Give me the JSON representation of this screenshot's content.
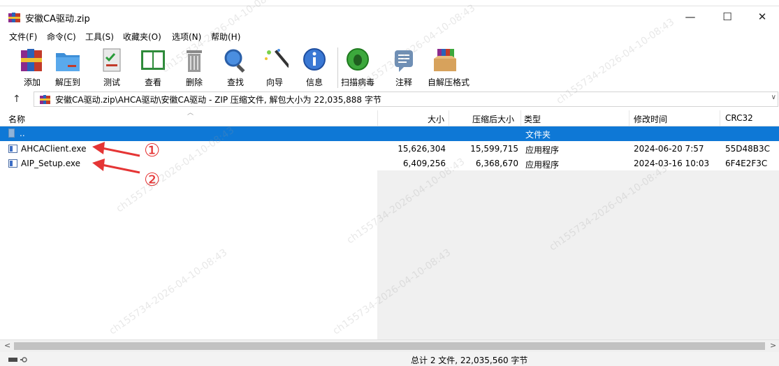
{
  "window": {
    "title": "安徽CA驱动.zip",
    "minimize": "—",
    "maximize": "☐",
    "close": "✕"
  },
  "menu": [
    "文件(F)",
    "命令(C)",
    "工具(S)",
    "收藏夹(O)",
    "选项(N)",
    "帮助(H)"
  ],
  "toolbar": [
    {
      "label": "添加",
      "icon": "books-icon"
    },
    {
      "label": "解压到",
      "icon": "folder-icon"
    },
    {
      "label": "测试",
      "icon": "checklist-icon"
    },
    {
      "label": "查看",
      "icon": "book-icon"
    },
    {
      "label": "删除",
      "icon": "trash-icon"
    },
    {
      "label": "查找",
      "icon": "magnifier-icon"
    },
    {
      "label": "向导",
      "icon": "wand-icon"
    },
    {
      "label": "信息",
      "icon": "info-icon"
    },
    {
      "label": "扫描病毒",
      "icon": "bug-icon"
    },
    {
      "label": "注释",
      "icon": "comment-icon"
    },
    {
      "label": "自解压格式",
      "icon": "box-icon"
    }
  ],
  "address": {
    "up": "↑",
    "path": "安徽CA驱动.zip\\AHCA驱动\\安徽CA驱动 - ZIP 压缩文件, 解包大小为 22,035,888 字节",
    "dropdown": "∨"
  },
  "columns": {
    "name": "名称",
    "size": "大小",
    "packed": "压缩后大小",
    "type": "类型",
    "modified": "修改时间",
    "crc": "CRC32"
  },
  "rows": [
    {
      "name": "..",
      "size": "",
      "packed": "",
      "type": "文件夹",
      "modified": "",
      "crc": ""
    },
    {
      "name": "AHCAClient.exe",
      "size": "15,626,304",
      "packed": "15,599,715",
      "type": "应用程序",
      "modified": "2024-06-20 7:57",
      "crc": "55D48B3C"
    },
    {
      "name": "AIP_Setup.exe",
      "size": "6,409,256",
      "packed": "6,368,670",
      "type": "应用程序",
      "modified": "2024-03-16 10:03",
      "crc": "6F4E2F3C"
    }
  ],
  "annotations": {
    "one": "①",
    "two": "②"
  },
  "scroll": {
    "left": "<",
    "right": ">"
  },
  "status": {
    "text": "总计 2 文件, 22,035,560 字节"
  },
  "watermarks": [
    "ch155734-2026-04-10-08:43",
    "ch155734-2026-04-10-08:43",
    "ch155734-2026-04-10-08:43",
    "ch155734-2026-04-10-08:43",
    "ch155734-2026-04-10-08:43",
    "ch155734-2026-04-10-08:43",
    "ch155734-2026-04-10-08:43",
    "ch155734-2026-04-10-08:43"
  ],
  "colors": {
    "selection": "#0e78d6",
    "callout": "#e53535"
  }
}
